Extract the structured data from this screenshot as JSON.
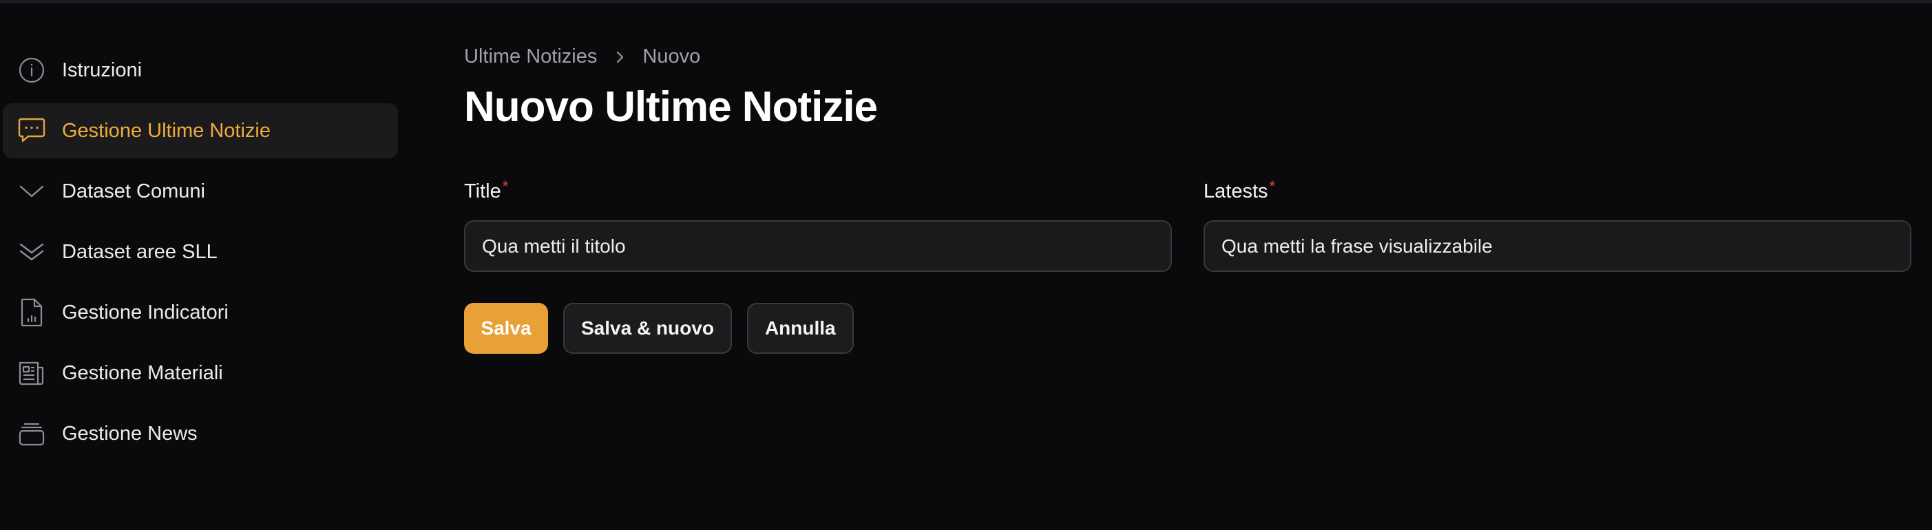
{
  "sidebar": {
    "items": [
      {
        "label": "Istruzioni",
        "icon": "info-icon",
        "active": false
      },
      {
        "label": "Gestione Ultime Notizie",
        "icon": "chat-icon",
        "active": true
      },
      {
        "label": "Dataset Comuni",
        "icon": "chevron-down-icon",
        "active": false
      },
      {
        "label": "Dataset aree SLL",
        "icon": "double-chevron-down-icon",
        "active": false
      },
      {
        "label": "Gestione Indicatori",
        "icon": "document-chart-icon",
        "active": false
      },
      {
        "label": "Gestione Materiali",
        "icon": "newspaper-icon",
        "active": false
      },
      {
        "label": "Gestione News",
        "icon": "archive-box-icon",
        "active": false
      }
    ]
  },
  "breadcrumb": {
    "parent": "Ultime Notizies",
    "current": "Nuovo"
  },
  "page": {
    "title": "Nuovo Ultime Notizie"
  },
  "form": {
    "title_field": {
      "label": "Title",
      "required_mark": "*",
      "value": "Qua metti il titolo"
    },
    "latests_field": {
      "label": "Latests",
      "required_mark": "*",
      "value": "Qua metti la frase visualizzabile"
    }
  },
  "actions": {
    "save": "Salva",
    "save_new": "Salva & nuovo",
    "cancel": "Annulla"
  },
  "colors": {
    "background": "#0a0a0c",
    "accent": "#e9a036",
    "required": "#e0483e"
  }
}
